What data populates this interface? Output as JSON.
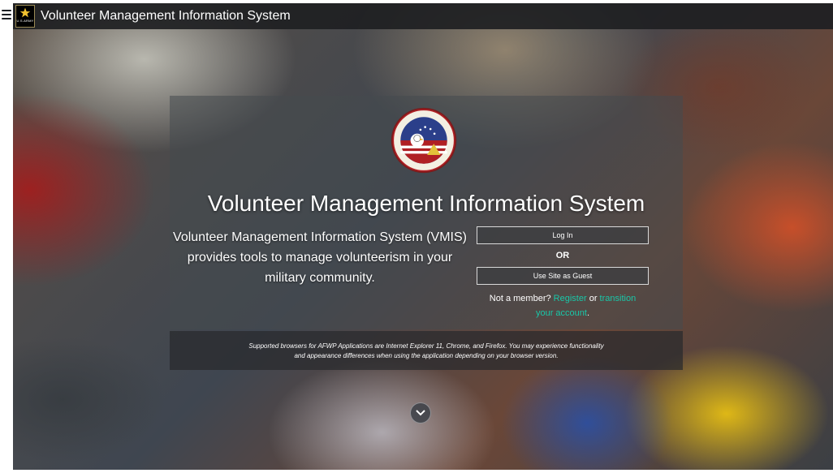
{
  "header": {
    "title": "Volunteer Management Information System",
    "logo_text": "U.S.ARMY"
  },
  "panel": {
    "heading": "Volunteer Management Information System",
    "description": "Volunteer Management Information System (VMIS) provides tools to manage volunteerism in your military community.",
    "login_label": "Log In",
    "or_label": "OR",
    "guest_label": "Use Site as Guest",
    "member_prefix": "Not a member?",
    "register_link": "Register",
    "or_word": "or",
    "transition_link": "transition your account",
    "period": "."
  },
  "footer": {
    "browser_notice": "Supported browsers for AFWP Applications are Internet Explorer 11, Chrome, and Firefox. You may experience functionality and appearance differences when using the application depending on your browser version."
  },
  "icons": {
    "menu": "hamburger-menu-icon",
    "logo": "army-star-logo",
    "seal": "army-volunteer-corps-seal",
    "scroll": "chevron-down-icon"
  },
  "colors": {
    "link": "#19c7a8",
    "topbar": "#1e2022"
  }
}
